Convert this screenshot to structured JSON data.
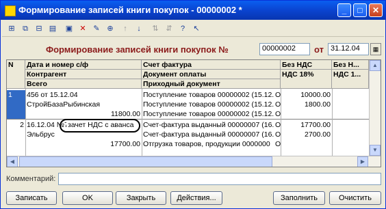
{
  "window": {
    "title": "Формирование записей книги покупок - 00000002 *",
    "min": "_",
    "max": "□",
    "close": "✕"
  },
  "toolbar": {
    "icons": [
      "add-row-icon",
      "copy-row-icon",
      "delete-row-icon",
      "edit-row-icon",
      "folder-icon",
      "delete-icon",
      "edit-icon",
      "tree-icon",
      "up-arrow-icon",
      "down-arrow-icon",
      "sort-asc-icon",
      "sort-desc-icon",
      "help-icon",
      "pointer-icon"
    ]
  },
  "header": {
    "heading": "Формирование записей книги покупок №",
    "number": "00000002",
    "from_label": "от",
    "date": "31.12.04"
  },
  "table": {
    "col_n": "N",
    "col_a": [
      "Дата и номер с/ф",
      "Контрагент",
      "Всего"
    ],
    "col_b": [
      "Счет фактура",
      "Документ оплаты",
      "Приходный документ"
    ],
    "col_c": [
      "Без НДС",
      "НДС 18%"
    ],
    "col_d": [
      "Без Н...",
      "НДС 1..."
    ],
    "rows": [
      {
        "n": "1",
        "a": [
          "456 от 15.12.04",
          "СтройБазаРыбинская",
          "11800.00"
        ],
        "b": [
          "Поступление товаров 00000002 (15.12.",
          "Поступление товаров 00000002 (15.12.",
          "Поступление товаров 00000002 (15.12."
        ],
        "flag": [
          "О",
          "О",
          "О"
        ],
        "c": [
          "10000.00",
          "1800.00",
          ""
        ]
      },
      {
        "n": "2",
        "a": [
          "16.12.04 №7",
          "Эльбрус",
          "17700.00"
        ],
        "a_note": "зачет НДС с аванса",
        "b": [
          "Счет-фактура выданный 00000007 (16.",
          "Счет-фактура выданный 00000007 (16.",
          "Отгрузка товаров, продукции 0000000"
        ],
        "flag": [
          "О",
          "О",
          "О"
        ],
        "c": [
          "17700.00",
          "2700.00",
          ""
        ]
      }
    ]
  },
  "comment_label": "Комментарий:",
  "buttons": {
    "write": "Записать",
    "ok": "OK",
    "close": "Закрыть",
    "actions": "Действия...",
    "fill": "Заполнить",
    "clear": "Очистить"
  }
}
